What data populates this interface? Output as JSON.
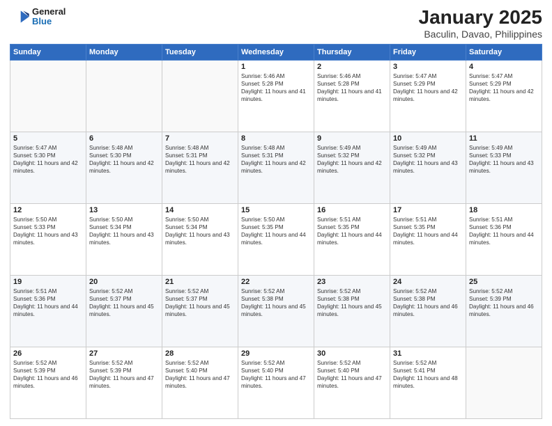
{
  "header": {
    "logo_line1": "General",
    "logo_line2": "Blue",
    "title": "January 2025",
    "subtitle": "Baculin, Davao, Philippines"
  },
  "days_of_week": [
    "Sunday",
    "Monday",
    "Tuesday",
    "Wednesday",
    "Thursday",
    "Friday",
    "Saturday"
  ],
  "weeks": [
    [
      {
        "day": "",
        "info": ""
      },
      {
        "day": "",
        "info": ""
      },
      {
        "day": "",
        "info": ""
      },
      {
        "day": "1",
        "info": "Sunrise: 5:46 AM\nSunset: 5:28 PM\nDaylight: 11 hours and 41 minutes."
      },
      {
        "day": "2",
        "info": "Sunrise: 5:46 AM\nSunset: 5:28 PM\nDaylight: 11 hours and 41 minutes."
      },
      {
        "day": "3",
        "info": "Sunrise: 5:47 AM\nSunset: 5:29 PM\nDaylight: 11 hours and 42 minutes."
      },
      {
        "day": "4",
        "info": "Sunrise: 5:47 AM\nSunset: 5:29 PM\nDaylight: 11 hours and 42 minutes."
      }
    ],
    [
      {
        "day": "5",
        "info": "Sunrise: 5:47 AM\nSunset: 5:30 PM\nDaylight: 11 hours and 42 minutes."
      },
      {
        "day": "6",
        "info": "Sunrise: 5:48 AM\nSunset: 5:30 PM\nDaylight: 11 hours and 42 minutes."
      },
      {
        "day": "7",
        "info": "Sunrise: 5:48 AM\nSunset: 5:31 PM\nDaylight: 11 hours and 42 minutes."
      },
      {
        "day": "8",
        "info": "Sunrise: 5:48 AM\nSunset: 5:31 PM\nDaylight: 11 hours and 42 minutes."
      },
      {
        "day": "9",
        "info": "Sunrise: 5:49 AM\nSunset: 5:32 PM\nDaylight: 11 hours and 42 minutes."
      },
      {
        "day": "10",
        "info": "Sunrise: 5:49 AM\nSunset: 5:32 PM\nDaylight: 11 hours and 43 minutes."
      },
      {
        "day": "11",
        "info": "Sunrise: 5:49 AM\nSunset: 5:33 PM\nDaylight: 11 hours and 43 minutes."
      }
    ],
    [
      {
        "day": "12",
        "info": "Sunrise: 5:50 AM\nSunset: 5:33 PM\nDaylight: 11 hours and 43 minutes."
      },
      {
        "day": "13",
        "info": "Sunrise: 5:50 AM\nSunset: 5:34 PM\nDaylight: 11 hours and 43 minutes."
      },
      {
        "day": "14",
        "info": "Sunrise: 5:50 AM\nSunset: 5:34 PM\nDaylight: 11 hours and 43 minutes."
      },
      {
        "day": "15",
        "info": "Sunrise: 5:50 AM\nSunset: 5:35 PM\nDaylight: 11 hours and 44 minutes."
      },
      {
        "day": "16",
        "info": "Sunrise: 5:51 AM\nSunset: 5:35 PM\nDaylight: 11 hours and 44 minutes."
      },
      {
        "day": "17",
        "info": "Sunrise: 5:51 AM\nSunset: 5:35 PM\nDaylight: 11 hours and 44 minutes."
      },
      {
        "day": "18",
        "info": "Sunrise: 5:51 AM\nSunset: 5:36 PM\nDaylight: 11 hours and 44 minutes."
      }
    ],
    [
      {
        "day": "19",
        "info": "Sunrise: 5:51 AM\nSunset: 5:36 PM\nDaylight: 11 hours and 44 minutes."
      },
      {
        "day": "20",
        "info": "Sunrise: 5:52 AM\nSunset: 5:37 PM\nDaylight: 11 hours and 45 minutes."
      },
      {
        "day": "21",
        "info": "Sunrise: 5:52 AM\nSunset: 5:37 PM\nDaylight: 11 hours and 45 minutes."
      },
      {
        "day": "22",
        "info": "Sunrise: 5:52 AM\nSunset: 5:38 PM\nDaylight: 11 hours and 45 minutes."
      },
      {
        "day": "23",
        "info": "Sunrise: 5:52 AM\nSunset: 5:38 PM\nDaylight: 11 hours and 45 minutes."
      },
      {
        "day": "24",
        "info": "Sunrise: 5:52 AM\nSunset: 5:38 PM\nDaylight: 11 hours and 46 minutes."
      },
      {
        "day": "25",
        "info": "Sunrise: 5:52 AM\nSunset: 5:39 PM\nDaylight: 11 hours and 46 minutes."
      }
    ],
    [
      {
        "day": "26",
        "info": "Sunrise: 5:52 AM\nSunset: 5:39 PM\nDaylight: 11 hours and 46 minutes."
      },
      {
        "day": "27",
        "info": "Sunrise: 5:52 AM\nSunset: 5:39 PM\nDaylight: 11 hours and 47 minutes."
      },
      {
        "day": "28",
        "info": "Sunrise: 5:52 AM\nSunset: 5:40 PM\nDaylight: 11 hours and 47 minutes."
      },
      {
        "day": "29",
        "info": "Sunrise: 5:52 AM\nSunset: 5:40 PM\nDaylight: 11 hours and 47 minutes."
      },
      {
        "day": "30",
        "info": "Sunrise: 5:52 AM\nSunset: 5:40 PM\nDaylight: 11 hours and 47 minutes."
      },
      {
        "day": "31",
        "info": "Sunrise: 5:52 AM\nSunset: 5:41 PM\nDaylight: 11 hours and 48 minutes."
      },
      {
        "day": "",
        "info": ""
      }
    ]
  ]
}
